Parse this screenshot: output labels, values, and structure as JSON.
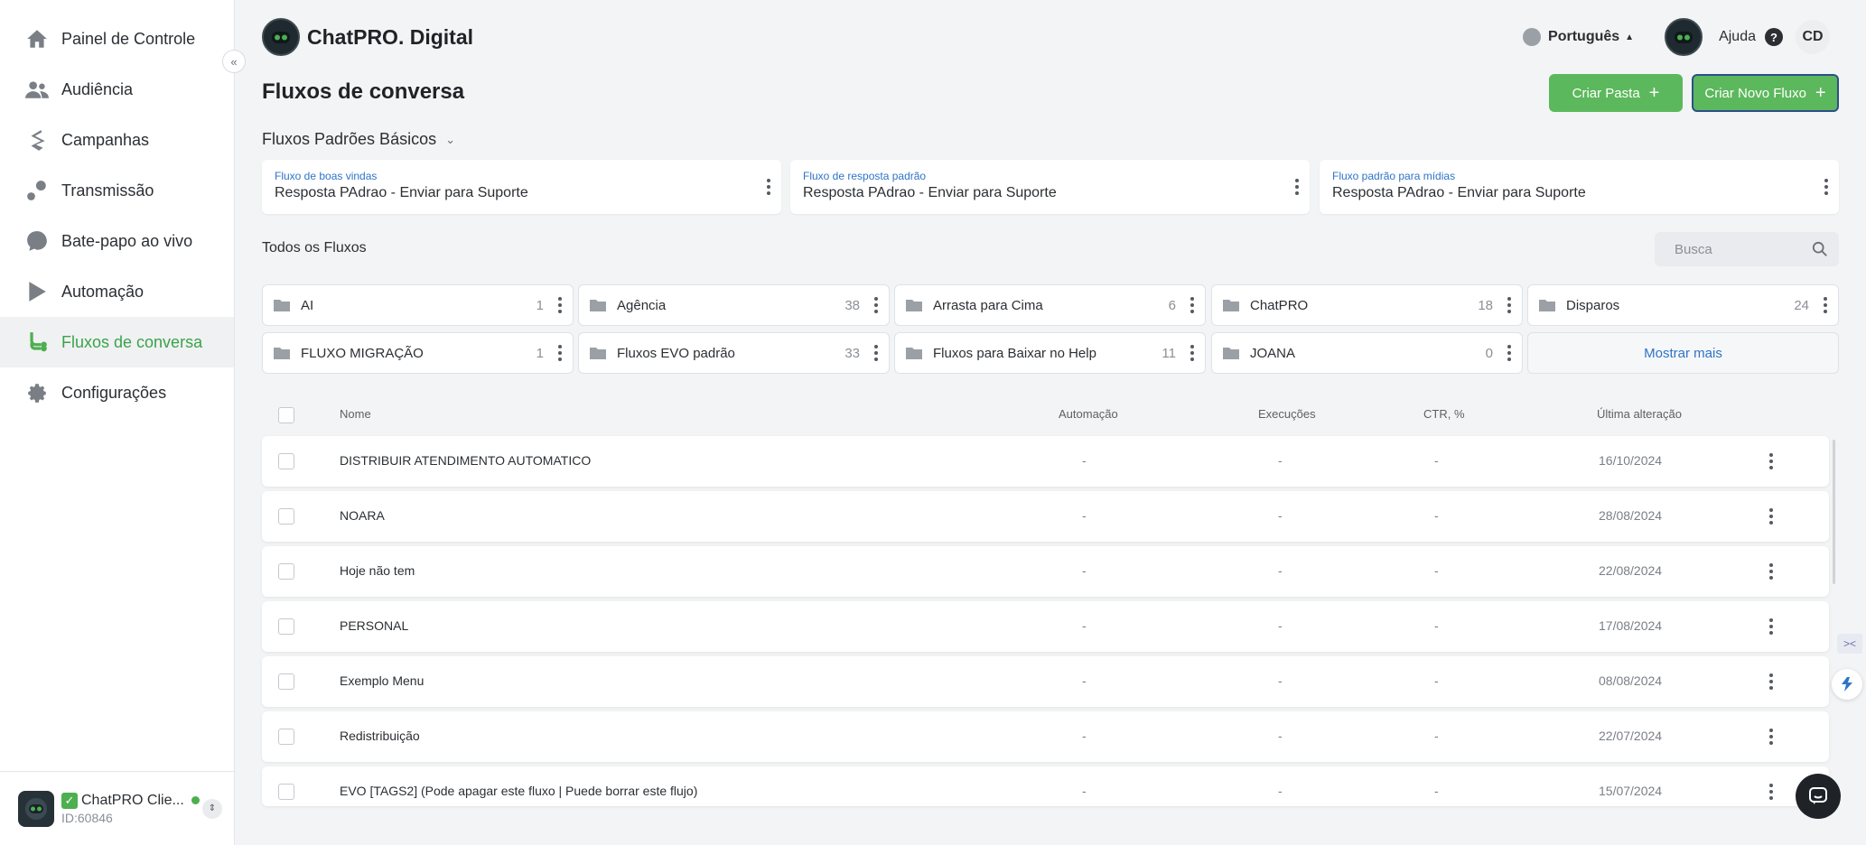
{
  "app": {
    "brand": "ChatPRO. Digital"
  },
  "sidebar": {
    "items": [
      {
        "label": "Painel de Controle",
        "icon": "home-icon"
      },
      {
        "label": "Audiência",
        "icon": "users-icon"
      },
      {
        "label": "Campanhas",
        "icon": "campaign-icon"
      },
      {
        "label": "Transmissão",
        "icon": "broadcast-icon"
      },
      {
        "label": "Bate-papo ao vivo",
        "icon": "chat-bubble-icon"
      },
      {
        "label": "Automação",
        "icon": "automation-icon"
      },
      {
        "label": "Fluxos de conversa",
        "icon": "flow-icon",
        "active": true
      },
      {
        "label": "Configurações",
        "icon": "gear-icon"
      }
    ],
    "collapse_label": "«",
    "account": {
      "check": "✓",
      "name": "ChatPRO Clie...",
      "id": "ID:60846",
      "switch": "⇕"
    }
  },
  "header": {
    "language": "Português",
    "language_caret": "▲",
    "help": "Ajuda",
    "help_icon": "?",
    "user_initials": "CD"
  },
  "page": {
    "title": "Fluxos de conversa",
    "create_folder": "Criar Pasta",
    "create_flow": "Criar Novo Fluxo",
    "plus": "+"
  },
  "defaults": {
    "title": "Fluxos Padrões Básicos",
    "chevron": "⌄",
    "cards": [
      {
        "label": "Fluxo de boas vindas",
        "value": "Resposta PAdrao - Enviar para Suporte"
      },
      {
        "label": "Fluxo de resposta padrão",
        "value": "Resposta PAdrao - Enviar para Suporte"
      },
      {
        "label": "Fluxo padrão para mídias",
        "value": "Resposta PAdrao - Enviar para Suporte"
      }
    ]
  },
  "all_flows": {
    "title": "Todos os Fluxos",
    "search_placeholder": "Busca",
    "folders": [
      {
        "name": "AI",
        "count": "1"
      },
      {
        "name": "Agência",
        "count": "38"
      },
      {
        "name": "Arrasta para Cima",
        "count": "6"
      },
      {
        "name": "ChatPRO",
        "count": "18"
      },
      {
        "name": "Disparos",
        "count": "24"
      },
      {
        "name": "FLUXO MIGRAÇÃO",
        "count": "1"
      },
      {
        "name": "Fluxos EVO padrão",
        "count": "33"
      },
      {
        "name": "Fluxos para Baixar no Help",
        "count": "11"
      },
      {
        "name": "JOANA",
        "count": "0"
      }
    ],
    "show_more": "Mostrar mais"
  },
  "table": {
    "headers": {
      "name": "Nome",
      "automation": "Automação",
      "executions": "Execuções",
      "ctr": "CTR, %",
      "last_change": "Última alteração"
    },
    "rows": [
      {
        "name": "DISTRIBUIR ATENDIMENTO AUTOMATICO",
        "automation": "-",
        "executions": "-",
        "ctr": "-",
        "date": "16/10/2024"
      },
      {
        "name": "NOARA",
        "automation": "-",
        "executions": "-",
        "ctr": "-",
        "date": "28/08/2024"
      },
      {
        "name": "Hoje não tem",
        "automation": "-",
        "executions": "-",
        "ctr": "-",
        "date": "22/08/2024"
      },
      {
        "name": "PERSONAL",
        "automation": "-",
        "executions": "-",
        "ctr": "-",
        "date": "17/08/2024"
      },
      {
        "name": "Exemplo Menu",
        "automation": "-",
        "executions": "-",
        "ctr": "-",
        "date": "08/08/2024"
      },
      {
        "name": "Redistribuição",
        "automation": "-",
        "executions": "-",
        "ctr": "-",
        "date": "22/07/2024"
      },
      {
        "name": "EVO [TAGS2] (Pode apagar este fluxo | Puede borrar este flujo)",
        "automation": "-",
        "executions": "-",
        "ctr": "-",
        "date": "15/07/2024"
      }
    ]
  },
  "colors": {
    "accent": "#5cb85c",
    "active_text": "#3aa34a",
    "link": "#2e74c7"
  }
}
